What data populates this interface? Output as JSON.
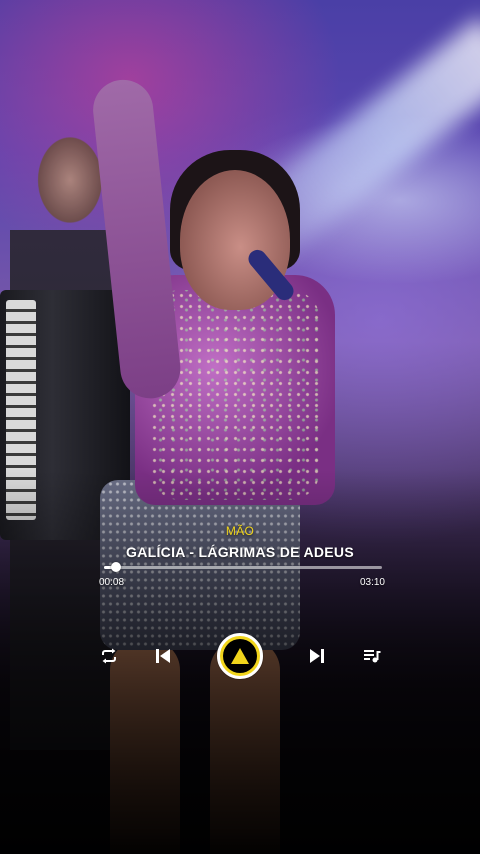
{
  "player": {
    "artist": "MÃO",
    "track_title": "GALÍCIA - LÁGRIMAS DE ADEUS",
    "elapsed": "00:08",
    "total": "03:10",
    "progress_fraction": 0.042
  },
  "controls": {
    "repeat_icon": "repeat-icon",
    "previous_icon": "skip-previous-icon",
    "play_icon": "play-triangle-icon",
    "next_icon": "skip-next-icon",
    "queue_icon": "playlist-queue-icon"
  },
  "colors": {
    "accent": "#f1d51c",
    "text": "#ffffff",
    "play_inner": "#000000"
  }
}
